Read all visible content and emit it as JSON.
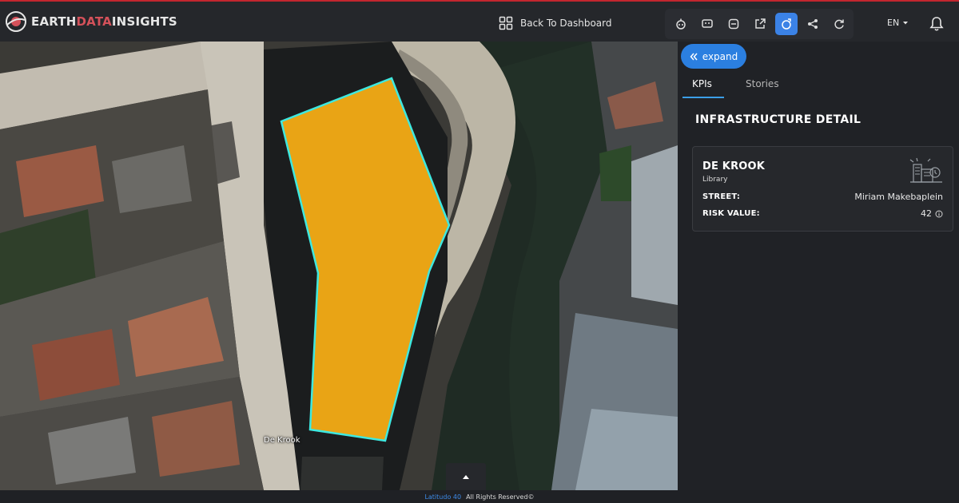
{
  "app": {
    "brand_part1": "EARTH",
    "brand_part2": "DATA",
    "brand_part3": "INSIGHTS"
  },
  "header": {
    "back_label": "Back To Dashboard",
    "language": "EN",
    "toolbar_icons": [
      "robot-icon",
      "monitor-face-icon",
      "layers-scan-icon",
      "share-box-icon",
      "rotate-3d-icon",
      "share-icon",
      "refresh-icon"
    ],
    "active_tool": "rotate-3d-icon"
  },
  "map": {
    "building_label": "De Krook",
    "highlight_fill": "#e9a415",
    "highlight_stroke": "#3ee8e0"
  },
  "panel": {
    "expand_label": "expand",
    "tabs": [
      {
        "label": "KPIs",
        "active": true
      },
      {
        "label": "Stories",
        "active": false
      }
    ],
    "section_title": "INFRASTRUCTURE DETAIL",
    "card": {
      "name": "DE KROOK",
      "type": "Library",
      "street_label": "STREET:",
      "street_value": "Miriam Makebaplein",
      "risk_label": "RISK VALUE:",
      "risk_value": "42"
    }
  },
  "footer": {
    "brand": "Latitudo 40",
    "rights": "All Rights Reserved©"
  },
  "colors": {
    "accent": "#2b7fe0",
    "header_border": "#c3262f"
  }
}
